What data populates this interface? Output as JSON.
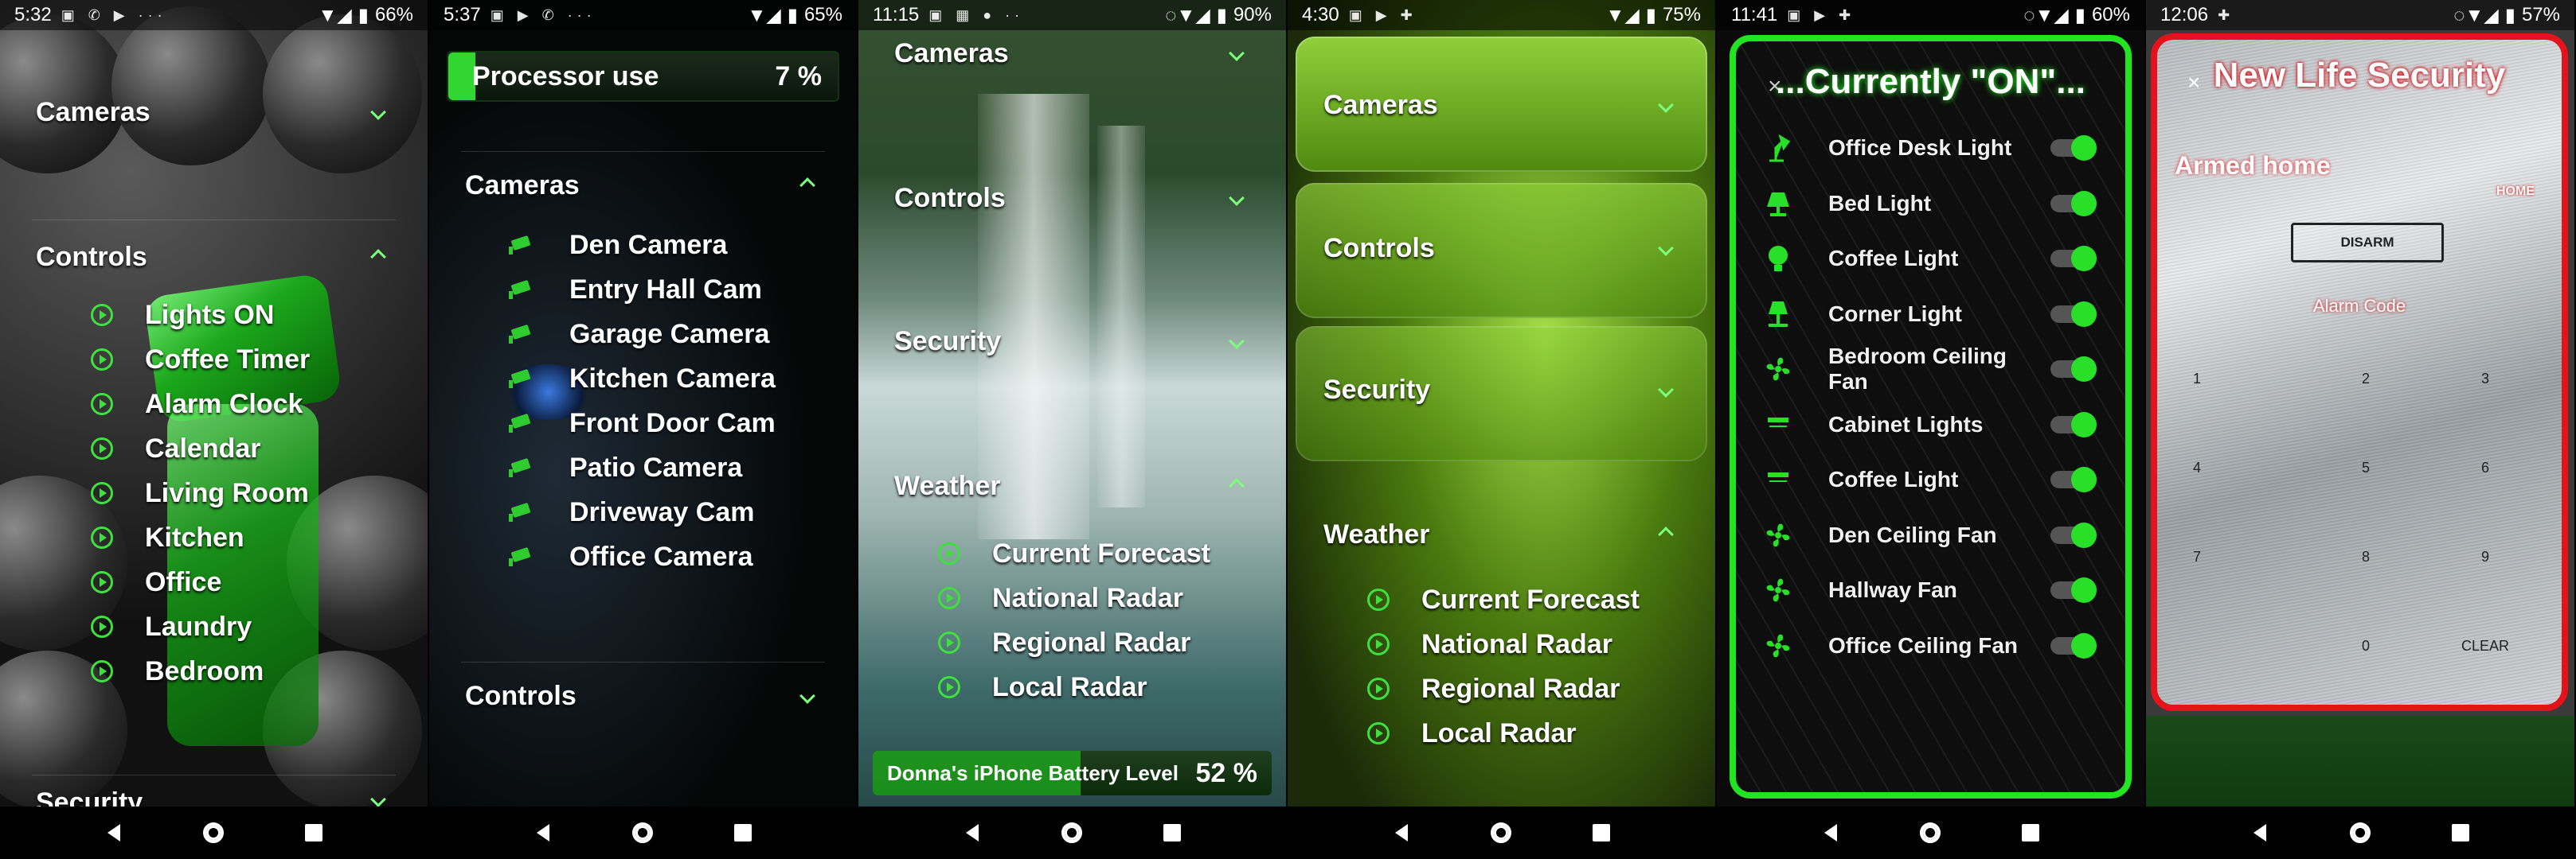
{
  "phones": [
    {
      "status": {
        "time": "5:32",
        "battery": "66%"
      },
      "sections": [
        {
          "title": "Cameras",
          "expanded": false
        },
        {
          "title": "Controls",
          "expanded": true,
          "items": [
            "Lights ON",
            "Coffee Timer",
            "Alarm Clock",
            "Calendar",
            "Living Room",
            "Kitchen",
            "Office",
            "Laundry",
            "Bedroom"
          ]
        },
        {
          "title": "Security",
          "expanded": false
        }
      ]
    },
    {
      "status": {
        "time": "5:37",
        "battery": "65%"
      },
      "processor": {
        "label": "Processor use",
        "value": "7 %",
        "fill_fraction": 0.07
      },
      "sections": [
        {
          "title": "Cameras",
          "expanded": true,
          "items": [
            "Den Camera",
            "Entry Hall Cam",
            "Garage Camera",
            "Kitchen Camera",
            "Front Door Cam",
            "Patio Camera",
            "Driveway Cam",
            "Office Camera"
          ]
        },
        {
          "title": "Controls",
          "expanded": false
        }
      ]
    },
    {
      "status": {
        "time": "11:15",
        "battery": "90%"
      },
      "sections": [
        {
          "title": "Cameras",
          "expanded": false
        },
        {
          "title": "Controls",
          "expanded": false
        },
        {
          "title": "Security",
          "expanded": false
        },
        {
          "title": "Weather",
          "expanded": true,
          "items": [
            "Current Forecast",
            "National Radar",
            "Regional Radar",
            "Local Radar"
          ]
        }
      ],
      "battery_widget": {
        "label": "Donna's iPhone Battery Level",
        "value": "52 %",
        "fill_fraction": 0.52
      }
    },
    {
      "status": {
        "time": "4:30",
        "battery": "75%"
      },
      "sections": [
        {
          "title": "Cameras",
          "expanded": false
        },
        {
          "title": "Controls",
          "expanded": false
        },
        {
          "title": "Security",
          "expanded": false
        },
        {
          "title": "Weather",
          "expanded": true,
          "items": [
            "Current Forecast",
            "National Radar",
            "Regional Radar",
            "Local Radar"
          ]
        }
      ]
    },
    {
      "status": {
        "time": "11:41",
        "battery": "60%"
      },
      "title": "...Currently \"ON\"...",
      "close": "×",
      "devices": [
        {
          "name": "Office Desk Light",
          "icon": "desk-lamp-icon",
          "on": true
        },
        {
          "name": "Bed Light",
          "icon": "lamp-icon",
          "on": true
        },
        {
          "name": "Coffee Light",
          "icon": "bulb-icon",
          "on": true
        },
        {
          "name": "Corner Light",
          "icon": "floor-lamp-icon",
          "on": true
        },
        {
          "name": "Bedroom Ceiling Fan",
          "icon": "fan-icon",
          "on": true
        },
        {
          "name": "Cabinet Lights",
          "icon": "strip-light-icon",
          "on": true
        },
        {
          "name": "Coffee Light",
          "icon": "strip-light-icon",
          "on": true
        },
        {
          "name": "Den Ceiling Fan",
          "icon": "fan-icon",
          "on": true
        },
        {
          "name": "Hallway Fan",
          "icon": "fan-icon",
          "on": true
        },
        {
          "name": "Office Ceiling Fan",
          "icon": "fan-icon",
          "on": true
        }
      ]
    },
    {
      "status": {
        "time": "12:06",
        "battery": "57%"
      },
      "title": "New Life Security",
      "close": "×",
      "mode": "Armed home",
      "mode_tag": "HOME",
      "disarm": "DISARM",
      "code_label": "Alarm Code",
      "keys": [
        "1",
        "2",
        "3",
        "4",
        "5",
        "6",
        "7",
        "8",
        "9",
        "0",
        "CLEAR"
      ]
    }
  ],
  "colors": {
    "accent_green": "#32d632",
    "alarm_red": "#e3121b"
  }
}
